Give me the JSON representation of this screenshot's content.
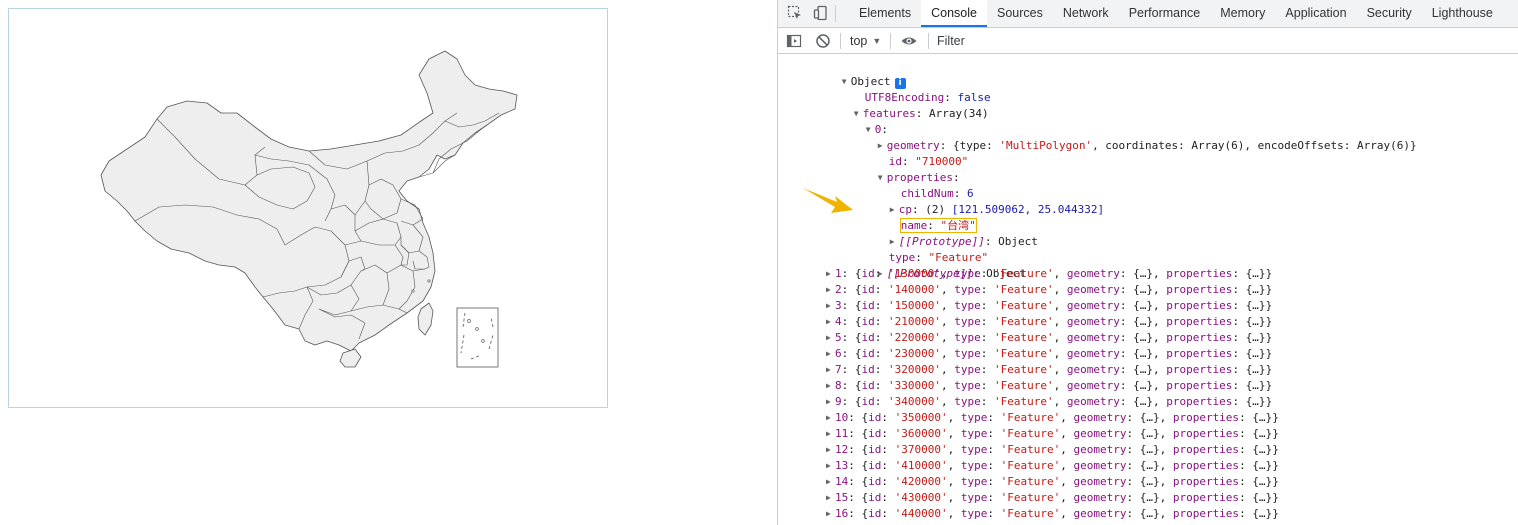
{
  "devtools": {
    "tabs": [
      "Elements",
      "Console",
      "Sources",
      "Network",
      "Performance",
      "Memory",
      "Application",
      "Security",
      "Lighthouse"
    ],
    "active_tab": "Console",
    "toolbar": {
      "context": "top",
      "filter_placeholder": "Filter"
    },
    "console": {
      "object_label": "Object",
      "utf8_key": "UTF8Encoding",
      "utf8_value": "false",
      "features_key": "features",
      "features_value": "Array(34)",
      "item0_key": "0",
      "geometry_key": "geometry",
      "geometry_value_prefix": "{type: ",
      "geometry_type": "'MultiPolygon'",
      "geometry_value_suffix": ", coordinates: Array(6), encodeOffsets: Array(6)}",
      "id_key": "id",
      "id_value": "\"710000\"",
      "properties_key": "properties",
      "childnum_key": "childNum",
      "childnum_value": "6",
      "cp_key": "cp",
      "cp_len": "(2) ",
      "cp_value": "[121.509062, 25.044332]",
      "name_key": "name",
      "name_value": "\"台湾\"",
      "prototype_key": "[[Prototype]]",
      "prototype_value": "Object",
      "type_key": "type",
      "type_value": "\"Feature\"",
      "rows": [
        {
          "index": "1",
          "id": "'130000'"
        },
        {
          "index": "2",
          "id": "'140000'"
        },
        {
          "index": "3",
          "id": "'150000'"
        },
        {
          "index": "4",
          "id": "'210000'"
        },
        {
          "index": "5",
          "id": "'220000'"
        },
        {
          "index": "6",
          "id": "'230000'"
        },
        {
          "index": "7",
          "id": "'320000'"
        },
        {
          "index": "8",
          "id": "'330000'"
        },
        {
          "index": "9",
          "id": "'340000'"
        },
        {
          "index": "10",
          "id": "'350000'"
        },
        {
          "index": "11",
          "id": "'360000'"
        },
        {
          "index": "12",
          "id": "'370000'"
        },
        {
          "index": "13",
          "id": "'410000'"
        },
        {
          "index": "14",
          "id": "'420000'"
        },
        {
          "index": "15",
          "id": "'430000'"
        },
        {
          "index": "16",
          "id": "'440000'"
        }
      ],
      "row_type": "'Feature'",
      "row_geometry": "{…}",
      "row_properties": "{…}"
    }
  },
  "colors": {
    "accent": "#1a73e8",
    "highlight": "#f0b400",
    "map_fill": "#eeeeee",
    "map_stroke": "#555555"
  }
}
